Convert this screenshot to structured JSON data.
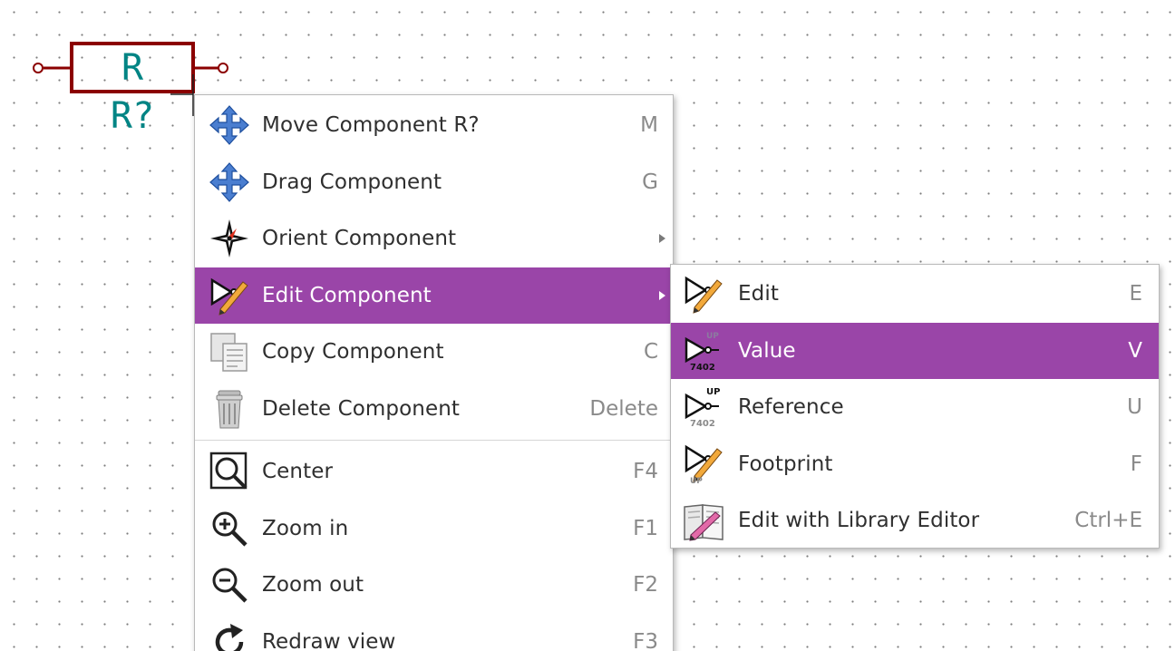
{
  "schematic": {
    "component_symbol": "R",
    "component_reference": "R?",
    "body_color": "#8b0000",
    "text_color": "#008484"
  },
  "theme": {
    "highlight": "#9a45a8"
  },
  "context_menu": {
    "items": [
      {
        "label": "Move Component R?",
        "shortcut": "M",
        "icon": "move-arrows-icon"
      },
      {
        "label": "Drag Component",
        "shortcut": "G",
        "icon": "move-arrows-icon"
      },
      {
        "label": "Orient Component",
        "shortcut": "",
        "icon": "compass-icon",
        "submenu": true
      },
      {
        "label": "Edit Component",
        "shortcut": "",
        "icon": "edit-component-icon",
        "submenu": true,
        "highlighted": true
      },
      {
        "label": "Copy Component",
        "shortcut": "C",
        "icon": "copy-icon"
      },
      {
        "label": "Delete Component",
        "shortcut": "Delete",
        "icon": "trash-icon"
      },
      {
        "label": "Center",
        "shortcut": "F4",
        "icon": "zoom-center-icon"
      },
      {
        "label": "Zoom in",
        "shortcut": "F1",
        "icon": "zoom-in-icon"
      },
      {
        "label": "Zoom out",
        "shortcut": "F2",
        "icon": "zoom-out-icon"
      },
      {
        "label": "Redraw view",
        "shortcut": "F3",
        "icon": "redraw-icon"
      }
    ]
  },
  "submenu": {
    "items": [
      {
        "label": "Edit",
        "shortcut": "E",
        "icon": "edit-component-icon"
      },
      {
        "label": "Value",
        "shortcut": "V",
        "icon": "edit-value-icon",
        "highlighted": true
      },
      {
        "label": "Reference",
        "shortcut": "U",
        "icon": "edit-reference-icon"
      },
      {
        "label": "Footprint",
        "shortcut": "F",
        "icon": "edit-footprint-icon"
      },
      {
        "label": "Edit with Library Editor",
        "shortcut": "Ctrl+E",
        "icon": "library-editor-icon"
      }
    ],
    "icon_texts": {
      "up": "UP",
      "part": "7402"
    }
  }
}
